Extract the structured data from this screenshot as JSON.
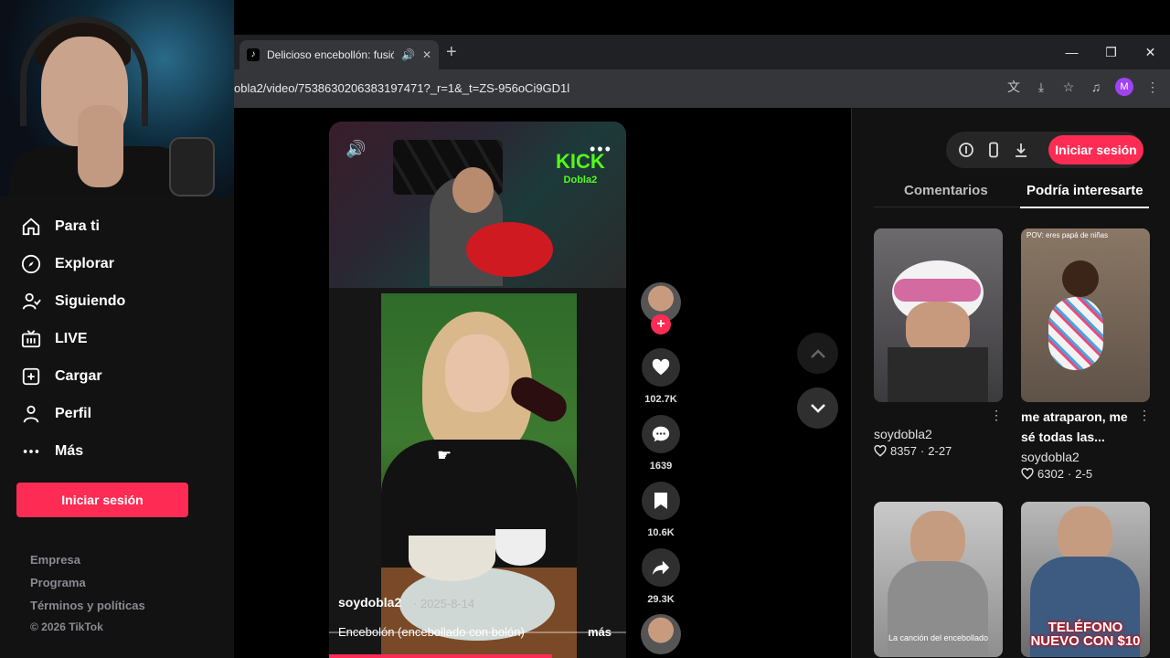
{
  "browser": {
    "tab_title": "Delicioso encebollón: fusió",
    "url": "obla2/video/7538630206383197471?_r=1&_t=ZS-956oCi9GD1l",
    "profile_initial": "M"
  },
  "sidebar": {
    "items": [
      {
        "label": "Para ti",
        "icon": "home-icon"
      },
      {
        "label": "Explorar",
        "icon": "compass-icon"
      },
      {
        "label": "Siguiendo",
        "icon": "following-icon"
      },
      {
        "label": "LIVE",
        "icon": "live-tv-icon"
      },
      {
        "label": "Cargar",
        "icon": "upload-icon"
      },
      {
        "label": "Perfil",
        "icon": "profile-icon"
      },
      {
        "label": "Más",
        "icon": "more-dots-icon"
      }
    ],
    "login_label": "Iniciar sesión",
    "footer": [
      "Empresa",
      "Programa",
      "Términos y políticas"
    ],
    "copyright": "© 2026 TikTok"
  },
  "video": {
    "overlay_brand": "KICK",
    "overlay_sub": "Dobla2",
    "author": "soydobla2",
    "date": "· 2025-8-14",
    "description": "Encebolón (encebollado con bolón)",
    "more_label": "más",
    "progress": 0.75
  },
  "actions": {
    "likes": "102.7K",
    "comments": "1639",
    "saves": "10.6K",
    "shares": "29.3K"
  },
  "right_panel": {
    "login_label": "Iniciar sesión",
    "tab_comments": "Comentarios",
    "tab_related": "Podría interesarte",
    "cards": [
      {
        "title": "",
        "author": "soydobla2",
        "likes": "8357",
        "date": "2-27"
      },
      {
        "title": "me atraparon, me sé todas las...",
        "caption": "POV: eres papá de niñas",
        "author": "soydobla2",
        "likes": "6302",
        "date": "2-5"
      },
      {
        "caption": "La canción del encebollado"
      },
      {
        "big_text": "TELÉFONO NUEVO CON $10"
      }
    ]
  },
  "colors": {
    "accent": "#fe2c55",
    "kick_green": "#53fc18"
  }
}
